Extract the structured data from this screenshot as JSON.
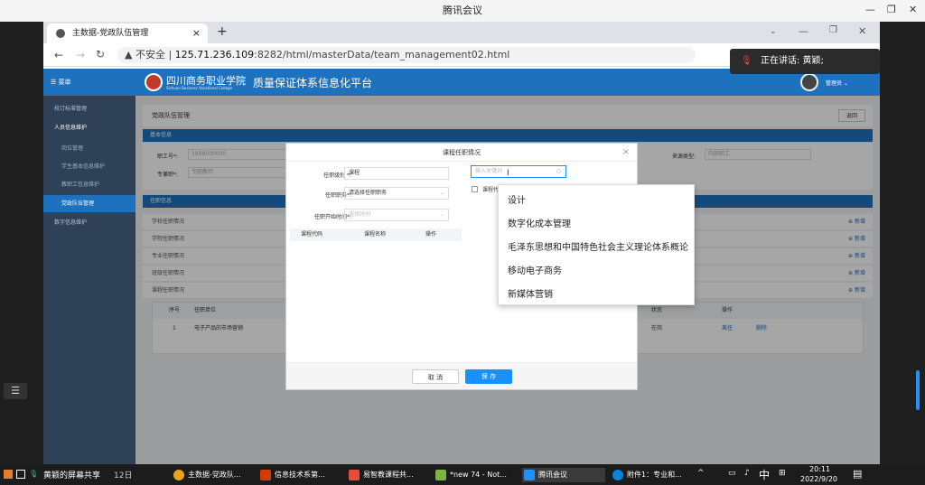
{
  "meeting_window": {
    "title": "腾讯会议",
    "minimize": "—",
    "restore": "❐",
    "close": "✕",
    "speaking_label": "正在讲话: 黄颖;"
  },
  "browser": {
    "tab_title": "主数据-党政队伍管理",
    "tab_close": "×",
    "new_tab": "+",
    "security_label": "▲ 不安全 |",
    "url_host": "125.71.236.109",
    "url_rest": ":8282/html/masterData/team_management02.html"
  },
  "app": {
    "menu_label": "菜单",
    "college_name": "Sichuan Business Vocational College",
    "platform_title": "质量保证体系信息化平台",
    "user_label": "管理员 ⌄"
  },
  "sidebar": {
    "items": [
      {
        "label": "校订标准管理"
      },
      {
        "label": "人员信息维护"
      },
      {
        "label": "岗位管理"
      },
      {
        "label": "学生基本信息维护"
      },
      {
        "label": "教职工信息维护"
      },
      {
        "label": "党政队伍管理"
      },
      {
        "label": "数字信息维护"
      }
    ]
  },
  "page": {
    "title": "党政队伍管理",
    "back_button": "返回",
    "basic_info": "基本信息",
    "employee_no_label": "职工号*:",
    "employee_no_value": "1998000000",
    "professional_label": "专兼职*:",
    "professional_value": "专职教师",
    "source_label": "来源类型:",
    "source_value": "内部职工",
    "position_info": "任职信息",
    "rows": [
      "学校任职情况",
      "学院任职情况",
      "专业任职情况",
      "班级任职情况",
      "课程任职情况"
    ],
    "add_label": "新增",
    "table_headers": [
      "序号",
      "任职单位",
      "状态",
      "操作"
    ],
    "table_row": {
      "no": "1",
      "unit": "电子产品的市场营销",
      "status": "在岗",
      "action_edit": "离任",
      "action_delete": "删除"
    }
  },
  "modal": {
    "title": "课程任职情况",
    "close": "×",
    "level_label": "任职级别 *:",
    "level_value": "课程",
    "duty_label": "任职职务*:",
    "duty_placeholder": "请选择任职职务",
    "start_label": "任职开始时间*:",
    "start_placeholder": "选择时间",
    "col_code": "课程代码",
    "col_name": "课程名称",
    "col_op": "操作",
    "search_placeholder": "输入关键词",
    "check_label": "课程代",
    "cancel": "取 消",
    "save": "保 存"
  },
  "dropdown": {
    "options": [
      "设计",
      "数字化成本管理",
      "毛泽东思想和中国特色社会主义理论体系概论",
      "移动电子商务",
      "新媒体营销"
    ]
  },
  "taskbar": {
    "left_text": "黄颖的屏幕共享",
    "date_partial": "12日",
    "items": [
      "主数据-党政队...",
      "信息技术系第...",
      "易智教课程共...",
      "*new 74 - Not...",
      "腾讯会议",
      "附件1：专业和..."
    ],
    "tray_up": "^",
    "ime": "中",
    "time": "20:11",
    "date": "2022/9/20"
  },
  "colors": {
    "brand_blue": "#1e72bd",
    "sidebar_bg": "#2f4156",
    "accent": "#1890ff"
  }
}
